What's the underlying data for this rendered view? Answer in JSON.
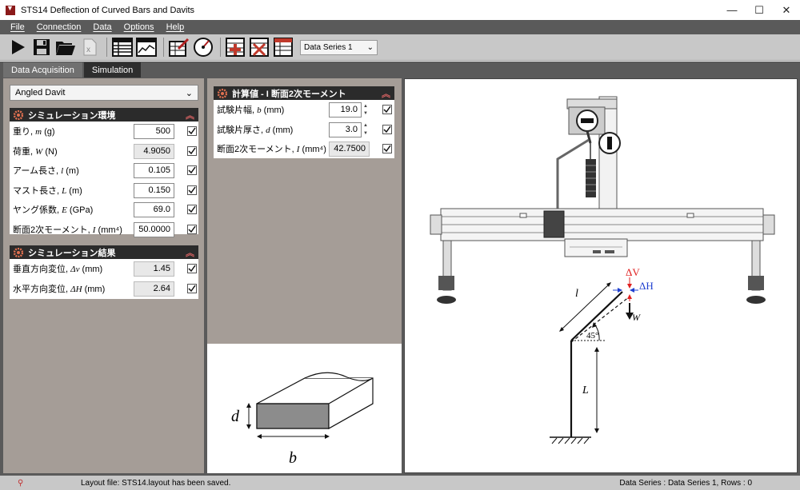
{
  "window": {
    "title": "STS14 Deflection of Curved Bars and Davits",
    "controls": [
      "—",
      "☐",
      "✕"
    ]
  },
  "menu": [
    "File",
    "Connection",
    "Data",
    "Options",
    "Help"
  ],
  "toolbar": {
    "series_select": "Data Series 1",
    "icons": [
      "run-icon",
      "save-icon",
      "open-icon",
      "excel-icon",
      "table-icon",
      "chart-icon",
      "edit-table-icon",
      "gauge-icon",
      "add-row-icon",
      "delete-row-icon",
      "table-settings-icon"
    ]
  },
  "tabs": [
    {
      "label": "Data Acquisition",
      "active": false
    },
    {
      "label": "Simulation",
      "active": true
    }
  ],
  "left": {
    "model_select": "Angled Davit",
    "env_panel": {
      "title": "シミュレーション環境",
      "rows": [
        {
          "label": "重り, ",
          "sym": "m",
          "unit": " (g)",
          "value": "500"
        },
        {
          "label": "荷重, ",
          "sym": "W",
          "unit": " (N)",
          "value": "4.9050"
        },
        {
          "label": "アーム長さ, ",
          "sym": "l",
          "unit": " (m)",
          "value": "0.105"
        },
        {
          "label": "マスト長さ, ",
          "sym": "L",
          "unit": " (m)",
          "value": "0.150"
        },
        {
          "label": "ヤング係数, ",
          "sym": "E",
          "unit": " (GPa)",
          "value": "69.0"
        },
        {
          "label": "断面2次モーメント, ",
          "sym": "I",
          "unit": " (mm⁴)",
          "value": "50.0000"
        }
      ]
    },
    "result_panel": {
      "title": "シミュレーション結果",
      "rows": [
        {
          "label": "垂直方向変位, ",
          "sym": "Δv",
          "unit": " (mm)",
          "value": "1.45"
        },
        {
          "label": "水平方向変位, ",
          "sym": "ΔH",
          "unit": " (mm)",
          "value": "2.64"
        }
      ]
    }
  },
  "middle": {
    "calc_panel": {
      "title": "計算値 - I 断面2次モーメント",
      "rows": [
        {
          "label": "試験片幅, ",
          "sym": "b",
          "unit": " (mm)",
          "value": "19.0"
        },
        {
          "label": "試験片厚さ, ",
          "sym": "d",
          "unit": " (mm)",
          "value": "3.0"
        },
        {
          "label": "断面2次モーメント, ",
          "sym": "I",
          "unit": " (mm⁴)",
          "value": "42.7500"
        }
      ]
    },
    "specimen_diagram": {
      "d_label": "d",
      "b_label": "b"
    }
  },
  "apparatus": {
    "diagram": {
      "delta_v": "ΔV",
      "delta_h": "ΔH",
      "arm_label": "l",
      "load_label": "W",
      "angle_label": "45°",
      "mast_label": "L"
    }
  },
  "status": {
    "message": "Layout file: STS14.layout has been saved.",
    "series_info": "Data Series : Data Series 1,  Rows : 0"
  }
}
